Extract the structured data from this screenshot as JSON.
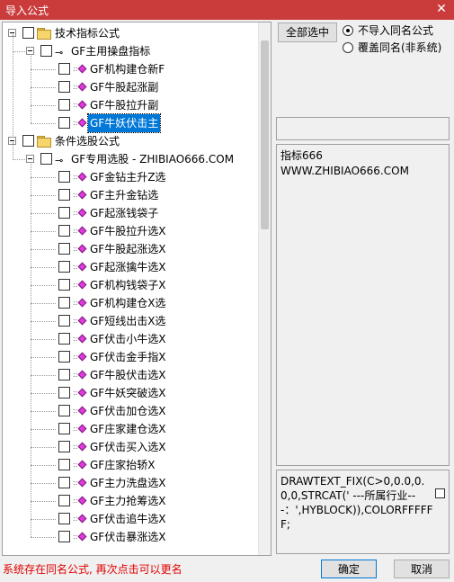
{
  "window": {
    "title": "导入公式",
    "close_glyph": "✕"
  },
  "tree": {
    "groups": [
      {
        "label": "技术指标公式",
        "sub": {
          "label": "GF主用操盘指标",
          "items": [
            {
              "label": "GF机构建仓新F",
              "selected": false
            },
            {
              "label": "GF牛股起涨副",
              "selected": false
            },
            {
              "label": "GF牛股拉升副",
              "selected": false
            },
            {
              "label": "GF牛妖伏击主",
              "selected": true
            }
          ]
        }
      },
      {
        "label": "条件选股公式",
        "sub": {
          "label": "GF专用选股 - ZHIBIAO666.COM",
          "items": [
            {
              "label": "GF金钻主升Z选"
            },
            {
              "label": "GF主升金钻选"
            },
            {
              "label": "GF起涨钱袋子"
            },
            {
              "label": "GF牛股拉升选X"
            },
            {
              "label": "GF牛股起涨选X"
            },
            {
              "label": "GF起涨擒牛选X"
            },
            {
              "label": "GF机构钱袋子X"
            },
            {
              "label": "GF机构建仓X选"
            },
            {
              "label": "GF短线出击X选"
            },
            {
              "label": "GF伏击小牛选X"
            },
            {
              "label": "GF伏击金手指X"
            },
            {
              "label": "GF牛股伏击选X"
            },
            {
              "label": "GF牛妖突破选X"
            },
            {
              "label": "GF伏击加仓选X"
            },
            {
              "label": "GF庄家建仓选X"
            },
            {
              "label": "GF伏击买入选X"
            },
            {
              "label": "GF庄家抬轿X"
            },
            {
              "label": "GF主力洗盘选X"
            },
            {
              "label": "GF主力抢筹选X"
            },
            {
              "label": "GF伏击追牛选X"
            },
            {
              "label": "GF伏击暴涨选X"
            }
          ]
        }
      }
    ]
  },
  "right_panel": {
    "select_all_label": "全部选中",
    "radio_skip_label": "不导入同名公式",
    "radio_overwrite_label": "覆盖同名(非系统)",
    "radio_selected": "skip",
    "description_line1": "指标666",
    "description_line2": "WWW.ZHIBIAO666.COM",
    "code_text": "DRAWTEXT_FIX(C>0,0.0,0.0,0,STRCAT(' ---所属行业---：',HYBLOCK)),COLORFFFFFF;"
  },
  "footer": {
    "status_text": "系统存在同名公式, 再次点击可以更名",
    "ok_label": "确定",
    "cancel_label": "取消"
  },
  "colors": {
    "titlebar": "#ca3c3c",
    "selection": "#0078d7",
    "status_text": "#e00000",
    "formula_diamond": "#e03adf"
  }
}
